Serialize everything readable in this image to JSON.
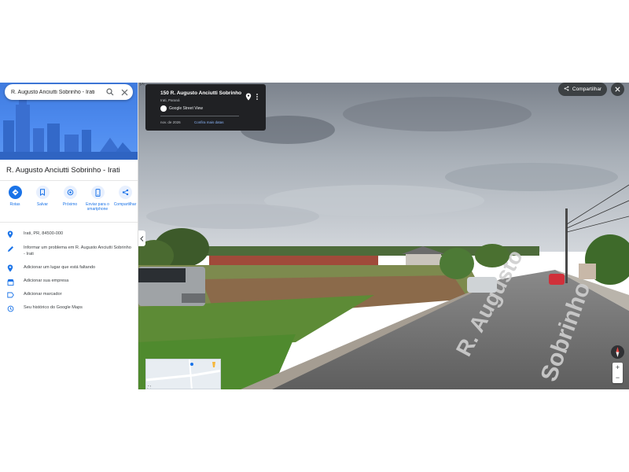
{
  "search": {
    "query": "R. Augusto Anciutti Sobrinho - Irati"
  },
  "place": {
    "title": "R. Augusto Anciutti Sobrinho - Irati"
  },
  "actions": [
    {
      "label": "Rotas",
      "icon": "directions-icon"
    },
    {
      "label": "Salvar",
      "icon": "bookmark-icon"
    },
    {
      "label": "Próximo",
      "icon": "nearby-icon"
    },
    {
      "label": "Enviar para o smartphone",
      "icon": "phone-icon"
    },
    {
      "label": "Compartilhar",
      "icon": "share-icon"
    }
  ],
  "info_items": [
    {
      "text": "Irati, PR, 84500-000",
      "icon": "location-pin-icon"
    },
    {
      "text": "Informar um problema em R. Augusto Anciutti Sobrinho - Irati",
      "icon": "edit-pencil-icon"
    },
    {
      "text": "Adicionar um lugar que está faltando",
      "icon": "add-place-icon"
    },
    {
      "text": "Adicionar sua empresa",
      "icon": "business-icon"
    },
    {
      "text": "Adicionar marcador",
      "icon": "label-icon"
    },
    {
      "text": "Seu histórico do Google Maps",
      "icon": "history-icon"
    }
  ],
  "streetview": {
    "address": "150 R. Augusto Anciutti Sobrinho",
    "region": "Irati, Paraná",
    "provider": "Google Street View",
    "date": "nov. de 2026",
    "more_dates": "Confira mais datas",
    "share_label": "Compartilhar",
    "road_text": [
      "R. Augusto",
      "Sobrinho"
    ]
  },
  "colors": {
    "accent": "#1a73e8",
    "panel_header": "#4f8cf0",
    "card_bg": "#202124"
  }
}
